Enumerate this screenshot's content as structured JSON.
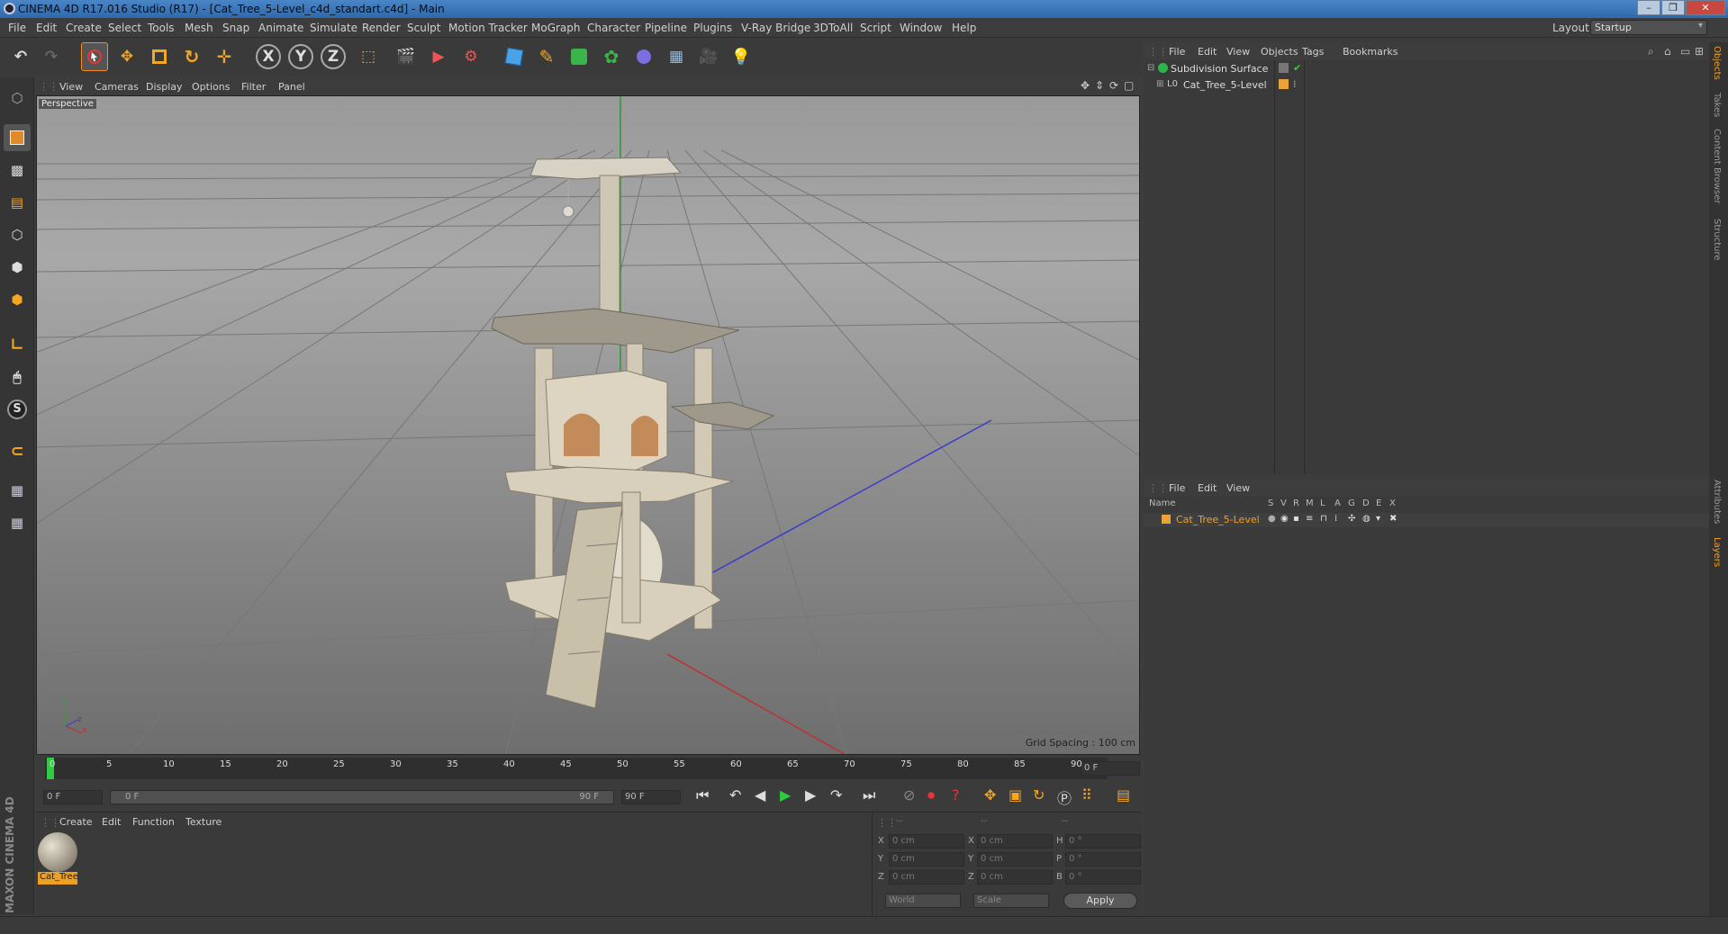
{
  "window": {
    "title": "CINEMA 4D R17.016 Studio (R17) - [Cat_Tree_5-Level_c4d_standart.c4d] - Main",
    "buttons": [
      "–",
      "❐",
      "✕"
    ]
  },
  "menubar": {
    "items": [
      "File",
      "Edit",
      "Create",
      "Select",
      "Tools",
      "Mesh",
      "Snap",
      "Animate",
      "Simulate",
      "Render",
      "Sculpt",
      "Motion Tracker",
      "MoGraph",
      "Character",
      "Pipeline",
      "Plugins",
      "V-Ray Bridge",
      "3DToAll",
      "Script",
      "Window",
      "Help"
    ],
    "layout_label": "Layout:",
    "layout_value": "Startup"
  },
  "toolbar": {
    "axis_x": "X",
    "axis_y": "Y",
    "axis_z": "Z"
  },
  "viewport": {
    "menu": [
      "View",
      "Cameras",
      "Display",
      "Options",
      "Filter",
      "Panel"
    ],
    "label": "Perspective",
    "grid_spacing": "Grid Spacing : 100 cm",
    "axis_labels": {
      "x": "x",
      "y": "y",
      "z": "z"
    }
  },
  "timeline": {
    "ticks": [
      "0",
      "5",
      "10",
      "15",
      "20",
      "25",
      "30",
      "35",
      "40",
      "45",
      "50",
      "55",
      "60",
      "65",
      "70",
      "75",
      "80",
      "85",
      "90"
    ],
    "current_frame": "0 F"
  },
  "transport": {
    "start_field": "0 F",
    "range_start": "0 F",
    "range_end": "90 F",
    "end_field": "90 F"
  },
  "material_manager": {
    "menu": [
      "Create",
      "Edit",
      "Function",
      "Texture"
    ],
    "material_name": "Cat_Tree"
  },
  "coordinates": {
    "headers": [
      "--",
      "--",
      "--"
    ],
    "rows": [
      {
        "l1": "X",
        "v1": "0 cm",
        "l2": "X",
        "v2": "0 cm",
        "l3": "H",
        "v3": "0 °"
      },
      {
        "l1": "Y",
        "v1": "0 cm",
        "l2": "Y",
        "v2": "0 cm",
        "l3": "P",
        "v3": "0 °"
      },
      {
        "l1": "Z",
        "v1": "0 cm",
        "l2": "Z",
        "v2": "0 cm",
        "l3": "B",
        "v3": "0 °"
      }
    ],
    "mode_world": "World",
    "mode_scale": "Scale",
    "apply": "Apply"
  },
  "object_manager": {
    "menu": [
      "File",
      "Edit",
      "View",
      "Objects",
      "Tags",
      "Bookmarks"
    ],
    "objects": [
      {
        "name": "Subdivision Surface"
      },
      {
        "name": "Cat_Tree_5-Level"
      }
    ]
  },
  "layer_manager": {
    "menu": [
      "File",
      "Edit",
      "View"
    ],
    "columns": [
      "Name",
      "S",
      "V",
      "R",
      "M",
      "L",
      "A",
      "G",
      "D",
      "E",
      "X"
    ],
    "layers": [
      {
        "name": "Cat_Tree_5-Level"
      }
    ]
  },
  "right_tabs": [
    "Objects",
    "Takes",
    "Content Browser",
    "Structure",
    "Attributes",
    "Layers"
  ],
  "colors": {
    "accent_orange": "#f0a020",
    "layer_orange": "#e8a33a",
    "timeline_green": "#2ecc40",
    "axis_blue": "#3b3bcc",
    "axis_red": "#c03030",
    "axis_green": "#30a030"
  },
  "branding": "MAXON CINEMA 4D"
}
